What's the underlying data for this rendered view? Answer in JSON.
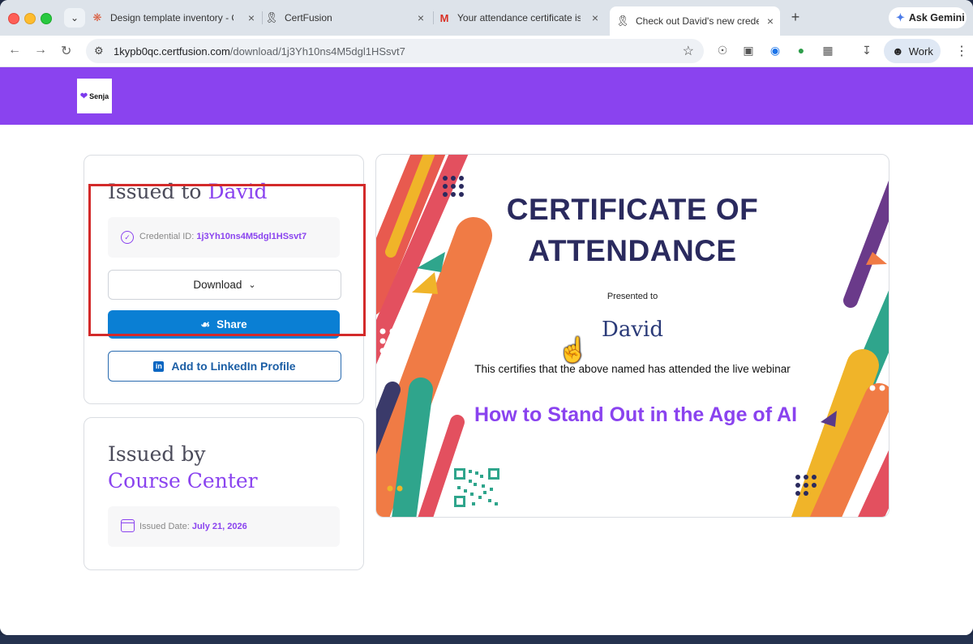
{
  "browser": {
    "tabs": [
      {
        "title": "Design template inventory - C",
        "icon": "asterisk-icon"
      },
      {
        "title": "CertFusion",
        "icon": "ribbon-icon"
      },
      {
        "title": "Your attendance certificate is",
        "icon": "gmail-icon"
      },
      {
        "title": "Check out David's new crede",
        "icon": "ribbon-icon",
        "active": true
      }
    ],
    "ask_gemini": "Ask Gemini",
    "url_host": "1kypb0qc.certfusion.com",
    "url_path": "/download/1j3Yh10ns4M5dgl1HSsvt7",
    "profile": "Work"
  },
  "header": {
    "logo_text": "Senja",
    "brand_color": "#8a43ef"
  },
  "issued_to": {
    "prefix": "Issued to",
    "name": "David",
    "credential_label": "Credential ID:",
    "credential_id": "1j3Yh10ns4M5dgl1HSsvt7",
    "download_label": "Download",
    "share_label": "Share",
    "linkedin_label": "Add to LinkedIn Profile"
  },
  "issued_by": {
    "prefix": "Issued by",
    "org": "Course Center",
    "date_label": "Issued Date:",
    "date": "July 21, 2026"
  },
  "certificate": {
    "title_line1": "CERTIFICATE OF",
    "title_line2": "ATTENDANCE",
    "presented": "Presented to",
    "name": "David",
    "body": "This certifies that the above named has attended the live webinar",
    "event": "How to Stand Out in the Age of AI"
  },
  "colors": {
    "share_button": "#0a7fd4",
    "accent": "#8a43ef",
    "highlight_box": "#d32a2a"
  }
}
